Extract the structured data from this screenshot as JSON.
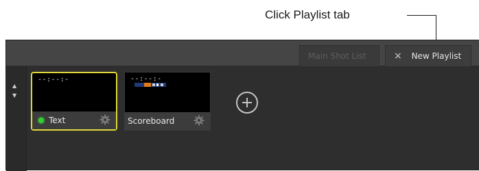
{
  "callout": {
    "text": "Click Playlist tab"
  },
  "tabs": [
    {
      "label": "Main Shot List",
      "active": false
    },
    {
      "label": "New Playlist",
      "active": true,
      "close_icon": "×"
    }
  ],
  "scroll": {
    "up_icon": "▲",
    "down_icon": "▼"
  },
  "cards": [
    {
      "label": "Text",
      "time": "--:--:-",
      "status": "live",
      "selected": true
    },
    {
      "label": "Scoreboard",
      "time": "--:--:-",
      "selected": false
    }
  ],
  "colors": {
    "selection_border": "#e1d83a",
    "status_green": "#2fd12f",
    "panel_bg": "#2e2e2e",
    "tabbar_bg": "#454545"
  },
  "icons": {
    "add": "plus-circle-icon",
    "settings": "gear-icon",
    "close": "close-icon"
  }
}
